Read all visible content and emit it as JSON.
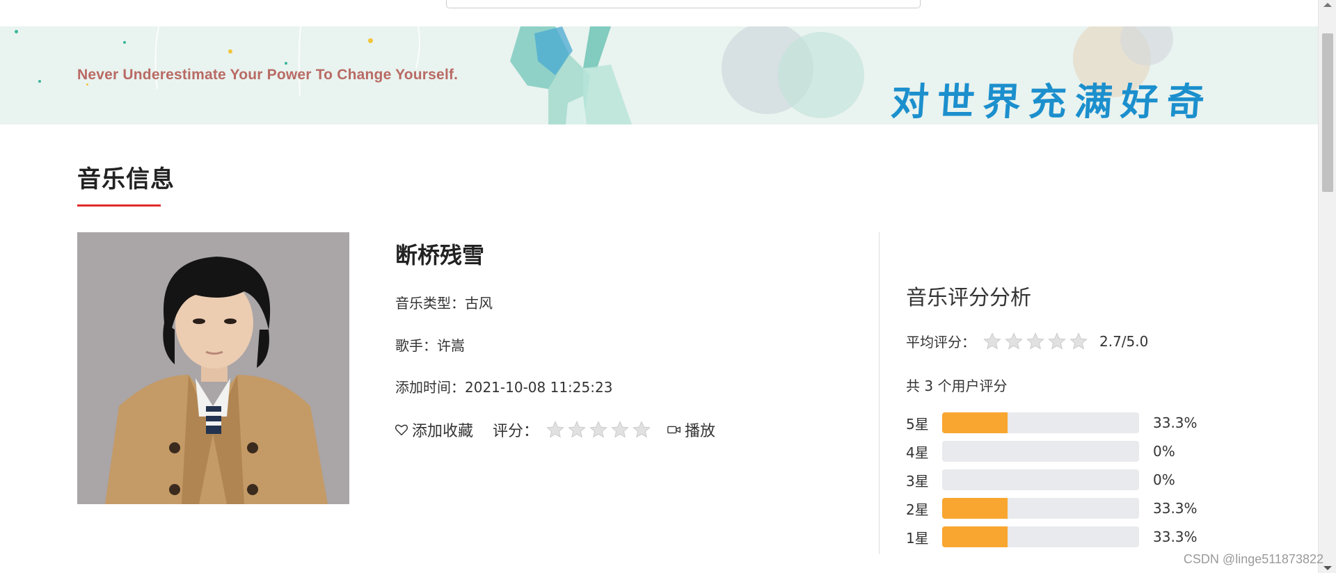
{
  "banner": {
    "slogan": "Never Underestimate Your Power To Change Yourself.",
    "chinese_text": "对世界充满好奇"
  },
  "section": {
    "title": "音乐信息"
  },
  "music": {
    "title": "断桥残雪",
    "type_label": "音乐类型：",
    "type_value": "古风",
    "singer_label": "歌手：",
    "singer_value": "许嵩",
    "added_label": "添加时间：",
    "added_value": "2021-10-08 11:25:23",
    "favorite_label": "添加收藏",
    "favorite_icon": "heart-icon",
    "rate_label": "评分：",
    "user_rating_stars": 0,
    "play_label": "播放",
    "play_icon": "video-camera-icon"
  },
  "rating_panel": {
    "title": "音乐评分分析",
    "avg_label": "平均评分：",
    "avg_value": "2.7/5.0",
    "avg_stars_filled": 0,
    "count_text": "共 3 个用户评分",
    "bars": [
      {
        "label": "5星",
        "percent_text": "33.3%",
        "fraction": 0.333
      },
      {
        "label": "4星",
        "percent_text": "0%",
        "fraction": 0
      },
      {
        "label": "3星",
        "percent_text": "0%",
        "fraction": 0
      },
      {
        "label": "2星",
        "percent_text": "33.3%",
        "fraction": 0.333
      },
      {
        "label": "1星",
        "percent_text": "33.3%",
        "fraction": 0.333
      }
    ],
    "bar_fill_color": "#f8a630",
    "bar_track_color": "#e8eaed"
  },
  "watermark": "CSDN @linge511873822",
  "colors": {
    "accent_red": "#e02b2b",
    "slogan_color": "#b96a64",
    "banner_text_blue": "#1c8fcd"
  }
}
